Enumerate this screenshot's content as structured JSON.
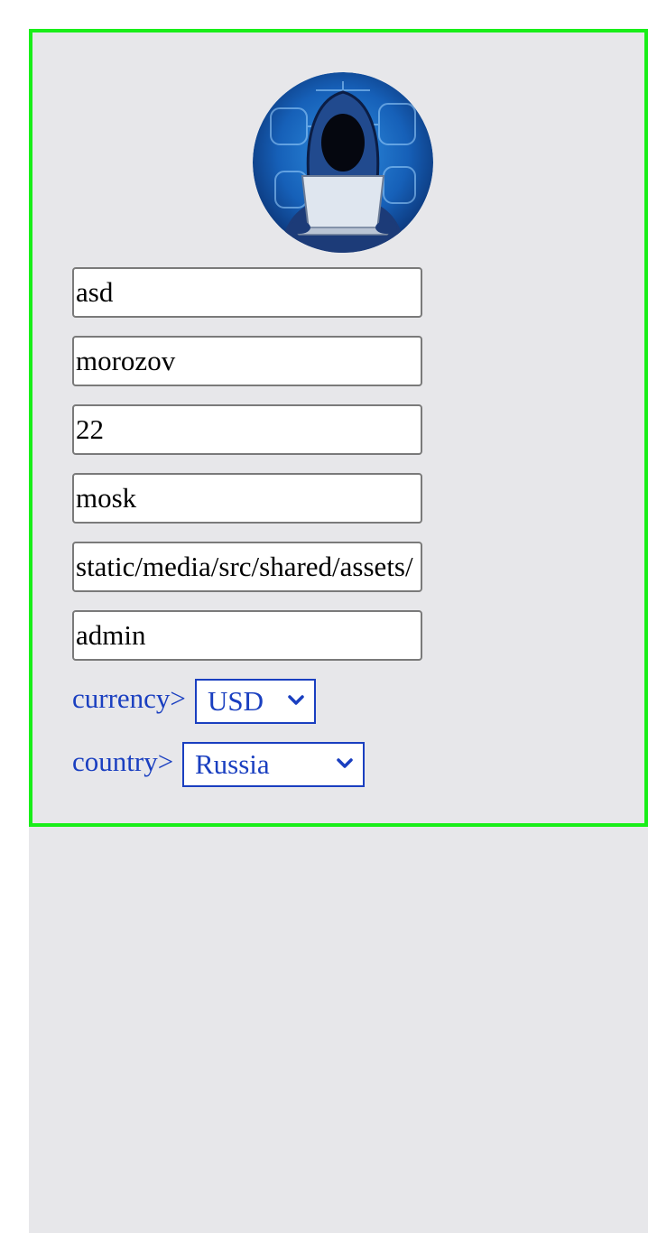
{
  "profile": {
    "avatar_icon": "hooded-hacker-avatar-icon",
    "fields": {
      "first_name": "asd",
      "last_name": "morozov",
      "age": "22",
      "city": "mosk",
      "avatar_path": "static/media/src/shared/assets/",
      "role": "admin"
    },
    "currency": {
      "label": "currency>",
      "selected": "USD"
    },
    "country": {
      "label": "country>",
      "selected": "Russia"
    }
  },
  "colors": {
    "card_border": "#19ee19",
    "card_background": "#e7e7ea",
    "select_accent": "#1a3fc0"
  }
}
